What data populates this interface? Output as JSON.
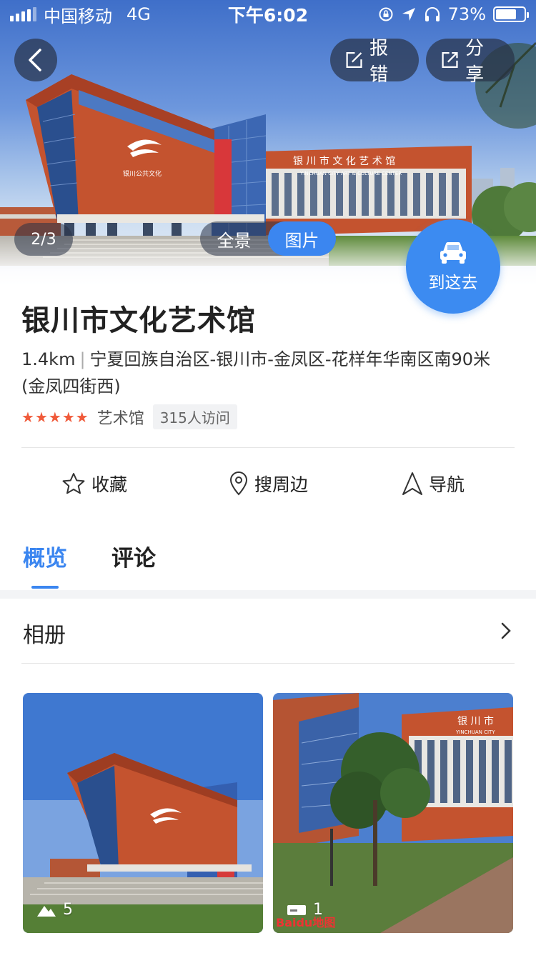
{
  "statusbar": {
    "carrier": "中国移动",
    "network": "4G",
    "time": "下午6:02",
    "battery": "73%",
    "battery_level": 0.73
  },
  "hero": {
    "report_label": "报错",
    "share_label": "分享",
    "counter": "2/3",
    "view_options": [
      "全景",
      "图片"
    ],
    "active_view": "图片",
    "go_label": "到这去",
    "facade_text_cn": "银 川 市 文 化 艺 术 馆",
    "facade_text_en": "YINCHUAN CITY ART & CULTURE CENTER",
    "facade_logo_text": "银川公共文化"
  },
  "place": {
    "name": "银川市文化艺术馆",
    "distance": "1.4km",
    "address": "宁夏回族自治区-银川市-金凤区-花样年华南区南90米(金凤四街西)",
    "rating": 5,
    "category": "艺术馆",
    "visits": "315人访问"
  },
  "actions": {
    "favorite": "收藏",
    "nearby": "搜周边",
    "navigate": "导航"
  },
  "tabs": [
    "概览",
    "评论"
  ],
  "active_tab": "概览",
  "album": {
    "title": "相册",
    "photos": [
      {
        "count": "5",
        "icon": "mountain-icon"
      },
      {
        "count": "1",
        "icon": "panorama-icon",
        "watermark": "Baidu地图",
        "sign_text": "银 川 市",
        "sign_text_en": "YINCHUAN CITY"
      }
    ]
  },
  "colors": {
    "accent": "#3b86f0",
    "star": "#f05a3a",
    "brick": "#c4532f"
  }
}
